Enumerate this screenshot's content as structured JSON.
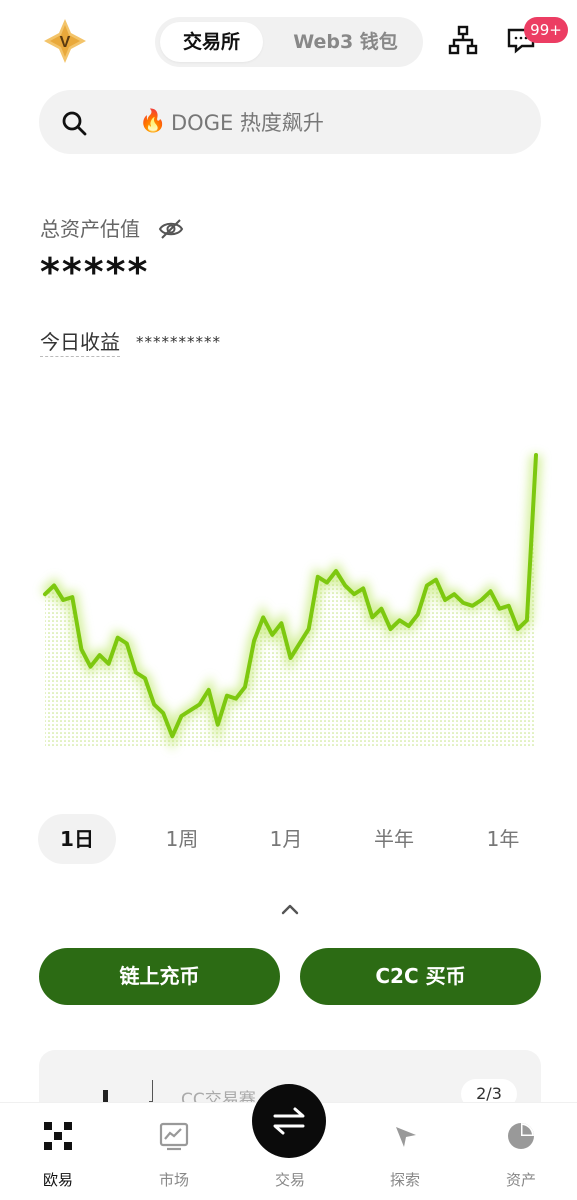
{
  "header": {
    "segments": [
      {
        "label": "交易所",
        "active": true
      },
      {
        "label": "Web3 钱包",
        "active": false
      }
    ],
    "notification_badge": "99+",
    "icons": [
      "okx-logo-icon",
      "org-chart-icon",
      "message-icon"
    ]
  },
  "search": {
    "icon": "search-icon",
    "hot_icon": "🔥",
    "placeholder": "DOGE 热度飙升"
  },
  "assets": {
    "total_label": "总资产估值",
    "total_value": "*****",
    "visibility_icon": "eye-off-icon",
    "pnl_label": "今日收益",
    "pnl_value": "**********"
  },
  "chart_data": {
    "type": "area",
    "color": "#7dc80f",
    "y": [
      52,
      55,
      50,
      51,
      33,
      27,
      31,
      28,
      37,
      35,
      25,
      23,
      14,
      11,
      3,
      10,
      12,
      14,
      19,
      7,
      17,
      16,
      20,
      36,
      44,
      38,
      42,
      30,
      35,
      40,
      58,
      56,
      60,
      55,
      52,
      54,
      44,
      47,
      40,
      43,
      41,
      45,
      55,
      57,
      50,
      52,
      49,
      48,
      50,
      53,
      47,
      48,
      40,
      43,
      100
    ],
    "y_range": [
      0,
      100
    ]
  },
  "ranges": {
    "items": [
      "1日",
      "1周",
      "1月",
      "半年",
      "1年"
    ],
    "selected": "1日"
  },
  "actions": {
    "deposit_label": "链上充币",
    "c2c_label": "C2C 买币"
  },
  "promo": {
    "title": "CC交易赛",
    "page": "2/3"
  },
  "bottom_nav": {
    "items": [
      {
        "label": "欧易",
        "icon": "okx-grid-icon",
        "active": true
      },
      {
        "label": "市场",
        "icon": "market-chart-icon",
        "active": false
      },
      {
        "label": "交易",
        "icon": "swap-arrows-icon",
        "active": false
      },
      {
        "label": "探索",
        "icon": "compass-icon",
        "active": false
      },
      {
        "label": "资产",
        "icon": "pie-chart-icon",
        "active": false
      }
    ]
  },
  "colors": {
    "brand_green": "#2c6b14",
    "chart_line": "#7dc80f",
    "badge_red": "#ec3d63"
  }
}
